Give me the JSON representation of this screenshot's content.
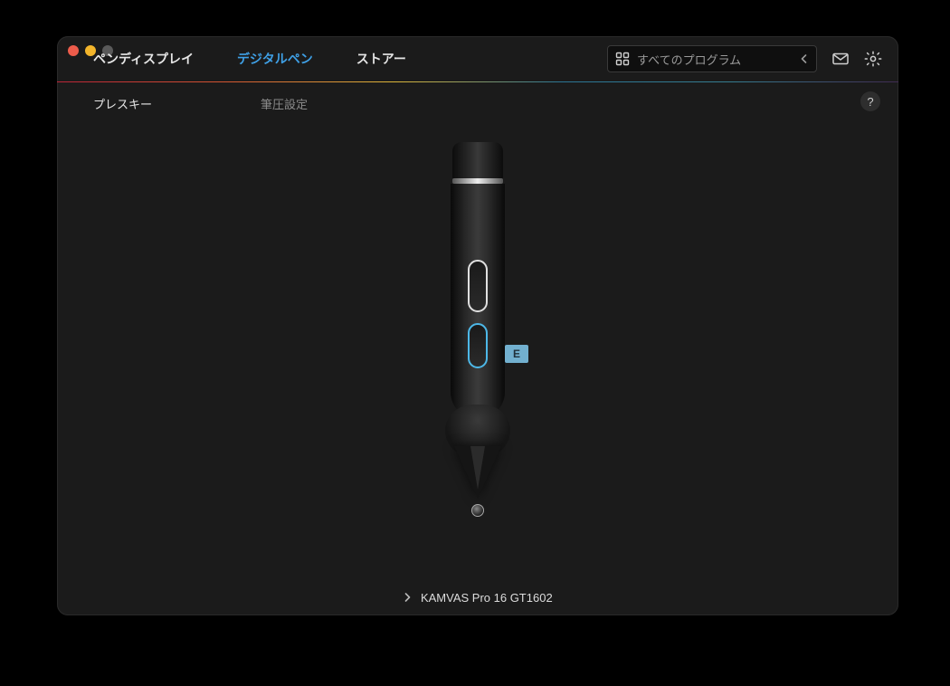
{
  "tabs": {
    "display": "ペンディスプレイ",
    "pen": "デジタルペン",
    "store": "ストアー"
  },
  "programs": {
    "label": "すべてのプログラム"
  },
  "subtabs": {
    "presskey": "プレスキー",
    "pressure": "筆圧設定"
  },
  "help_label": "?",
  "pen": {
    "lower_button_key": "E"
  },
  "device": {
    "name": "KAMVAS Pro 16 GT1602"
  }
}
